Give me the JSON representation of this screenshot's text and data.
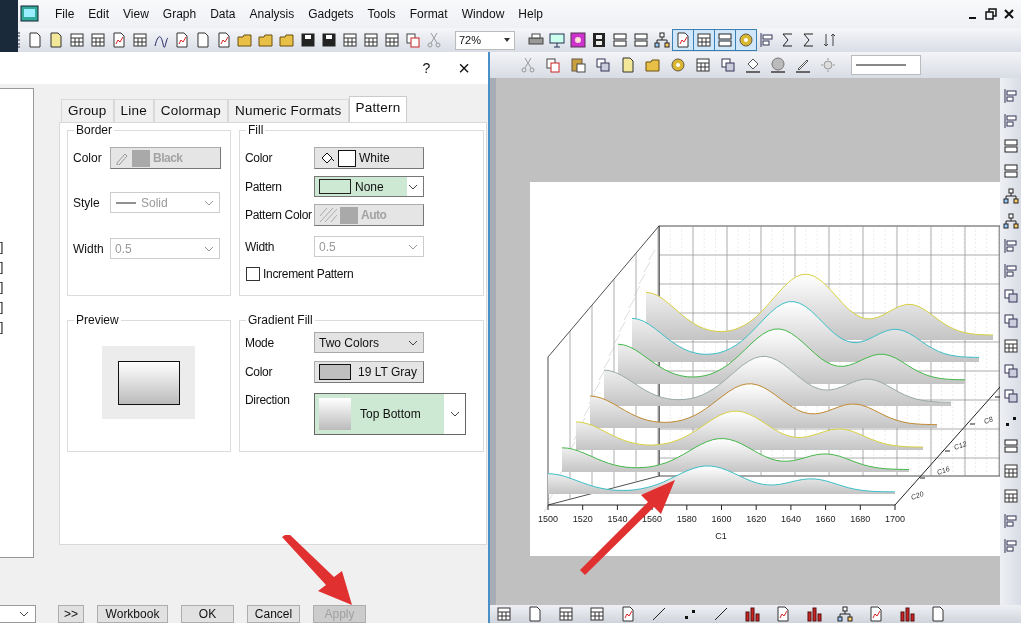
{
  "menu_bar": {
    "items": [
      "File",
      "Edit",
      "View",
      "Graph",
      "Data",
      "Analysis",
      "Gadgets",
      "Tools",
      "Format",
      "Window",
      "Help"
    ]
  },
  "toolbar": {
    "zoom": "72%"
  },
  "dialog": {
    "help": "?",
    "close": "×",
    "left_list": {
      "items": [
        "]",
        "]",
        "]",
        "]",
        "]"
      ]
    },
    "tabs": [
      {
        "label": "Group",
        "selected": false
      },
      {
        "label": "Line",
        "selected": false
      },
      {
        "label": "Colormap",
        "selected": false
      },
      {
        "label": "Numeric Formats",
        "selected": false
      },
      {
        "label": "Pattern",
        "selected": true
      }
    ],
    "border": {
      "title": "Border",
      "disabled": true,
      "color_label": "Color",
      "color_value": "Black",
      "style_label": "Style",
      "style_value": "Solid",
      "width_label": "Width",
      "width_value": "0.5"
    },
    "fill": {
      "title": "Fill",
      "color_label": "Color",
      "color_value": "White",
      "pattern_label": "Pattern",
      "pattern_value": "None",
      "pattern_color_label": "Pattern Color",
      "pattern_color_value": "Auto",
      "width_label": "Width",
      "width_value": "0.5",
      "increment": {
        "label": "Increment Pattern",
        "checked": false
      }
    },
    "preview": {
      "title": "Preview"
    },
    "gradient": {
      "title": "Gradient Fill",
      "mode_label": "Mode",
      "mode_value": "Two Colors",
      "color_label": "Color",
      "color_value": "19 LT Gray",
      "direction_label": "Direction",
      "direction_value": "Top Bottom"
    },
    "buttons": [
      {
        "label": ">>",
        "disabled": false
      },
      {
        "label": "Workbook",
        "disabled": false
      },
      {
        "label": "OK",
        "disabled": false
      },
      {
        "label": "Cancel",
        "disabled": false
      },
      {
        "label": "Apply",
        "disabled": true
      }
    ]
  },
  "graph": {
    "x_ticks": [
      "1500",
      "1520",
      "1540",
      "1560",
      "1580",
      "1600",
      "1620",
      "1640",
      "1660",
      "1680",
      "1700"
    ],
    "x_title": "C1",
    "series_labels": [
      "C20",
      "C16",
      "C12",
      "C8"
    ]
  }
}
